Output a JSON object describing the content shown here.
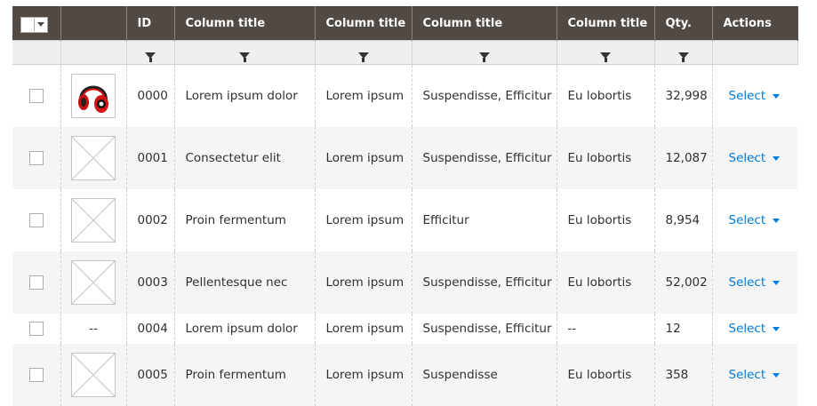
{
  "header": {
    "columns": [
      {
        "key": "select",
        "label": ""
      },
      {
        "key": "image",
        "label": ""
      },
      {
        "key": "id",
        "label": "ID"
      },
      {
        "key": "c1",
        "label": "Column title"
      },
      {
        "key": "c2",
        "label": "Column title"
      },
      {
        "key": "c3",
        "label": "Column title"
      },
      {
        "key": "c4",
        "label": "Column title"
      },
      {
        "key": "qty",
        "label": "Qty."
      },
      {
        "key": "actions",
        "label": "Actions"
      }
    ]
  },
  "filters": [
    "",
    "",
    "funnel-icon",
    "funnel-icon",
    "funnel-icon",
    "funnel-icon",
    "funnel-icon",
    "funnel-icon",
    ""
  ],
  "rows": [
    {
      "image": "headphones",
      "id": "0000",
      "c1": "Lorem ipsum dolor",
      "c2": "Lorem ipsum",
      "c3": "Suspendisse, Efficitur",
      "c4": "Eu lobortis",
      "qty": "32,998",
      "action": "Select"
    },
    {
      "image": "placeholder",
      "id": "0001",
      "c1": "Consectetur elit",
      "c2": "Lorem ipsum",
      "c3": "Suspendisse, Efficitur",
      "c4": "Eu lobortis",
      "qty": "12,087",
      "action": "Select"
    },
    {
      "image": "placeholder",
      "id": "0002",
      "c1": "Proin fermentum",
      "c2": "Lorem ipsum",
      "c3": "Efficitur",
      "c4": "Eu lobortis",
      "qty": "8,954",
      "action": "Select"
    },
    {
      "image": "placeholder",
      "id": "0003",
      "c1": "Pellentesque nec",
      "c2": "Lorem ipsum",
      "c3": "Suspendisse, Efficitur",
      "c4": "Eu lobortis",
      "qty": "52,002",
      "action": "Select"
    },
    {
      "image": "none",
      "image_text": "--",
      "id": "0004",
      "c1": "Lorem ipsum dolor",
      "c2": "Lorem ipsum",
      "c3": "Suspendisse, Efficitur",
      "c4": "--",
      "qty": "12",
      "action": "Select"
    },
    {
      "image": "placeholder",
      "id": "0005",
      "c1": "Proin fermentum",
      "c2": "Lorem ipsum",
      "c3": "Suspendisse",
      "c4": "Eu lobortis",
      "qty": "358",
      "action": "Select"
    }
  ],
  "colors": {
    "header_bg": "#514943",
    "link": "#007bdb",
    "row_alt": "#f5f5f5"
  }
}
